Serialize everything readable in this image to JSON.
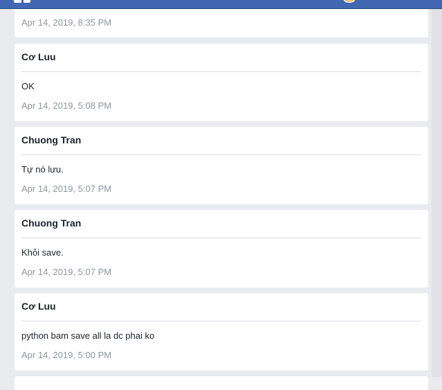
{
  "header": {
    "avatar": "avatar"
  },
  "first_card": {
    "time": "Apr 14, 2019, 8:35 PM"
  },
  "comments": [
    {
      "author": "Cơ Luu",
      "message": "OK",
      "time": "Apr 14, 2019, 5:08 PM"
    },
    {
      "author": "Chuong Tran",
      "message": "Tự nó lưu.",
      "time": "Apr 14, 2019, 5:07 PM"
    },
    {
      "author": "Chuong Tran",
      "message": "Khỏi save.",
      "time": "Apr 14, 2019, 5:07 PM"
    },
    {
      "author": "Cơ Luu",
      "message": "python bam save all la dc phai ko",
      "time": "Apr 14, 2019, 5:00 PM"
    }
  ]
}
